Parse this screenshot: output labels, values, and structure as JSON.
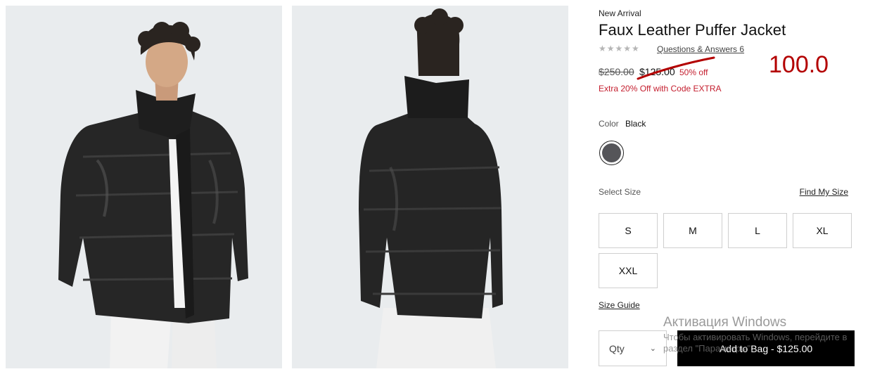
{
  "product": {
    "badge": "New Arrival",
    "title": "Faux Leather Puffer Jacket",
    "stars": "★★★★★",
    "qa_link": "Questions & Answers 6",
    "price_original": "$250.00",
    "price_sale": "$125.00",
    "discount": "50% off",
    "promo": "Extra 20% Off with Code EXTRA",
    "overlay_value": "100.0"
  },
  "color": {
    "label": "Color",
    "value": "Black",
    "swatch_hex": "#555559"
  },
  "size": {
    "label": "Select Size",
    "find_link": "Find My Size",
    "options": [
      "S",
      "M",
      "L",
      "XL",
      "XXL"
    ],
    "guide_link": "Size Guide"
  },
  "purchase": {
    "qty_label": "Qty",
    "add_to_bag": "Add to Bag - $125.00"
  },
  "activation": {
    "title": "Активация Windows",
    "subtitle": "Чтобы активировать Windows, перейдите в раздел \"Параметры\"."
  },
  "colors": {
    "sale_red": "#c41e2e",
    "overlay_red": "#b30000",
    "image_bg": "#e9ecee"
  }
}
